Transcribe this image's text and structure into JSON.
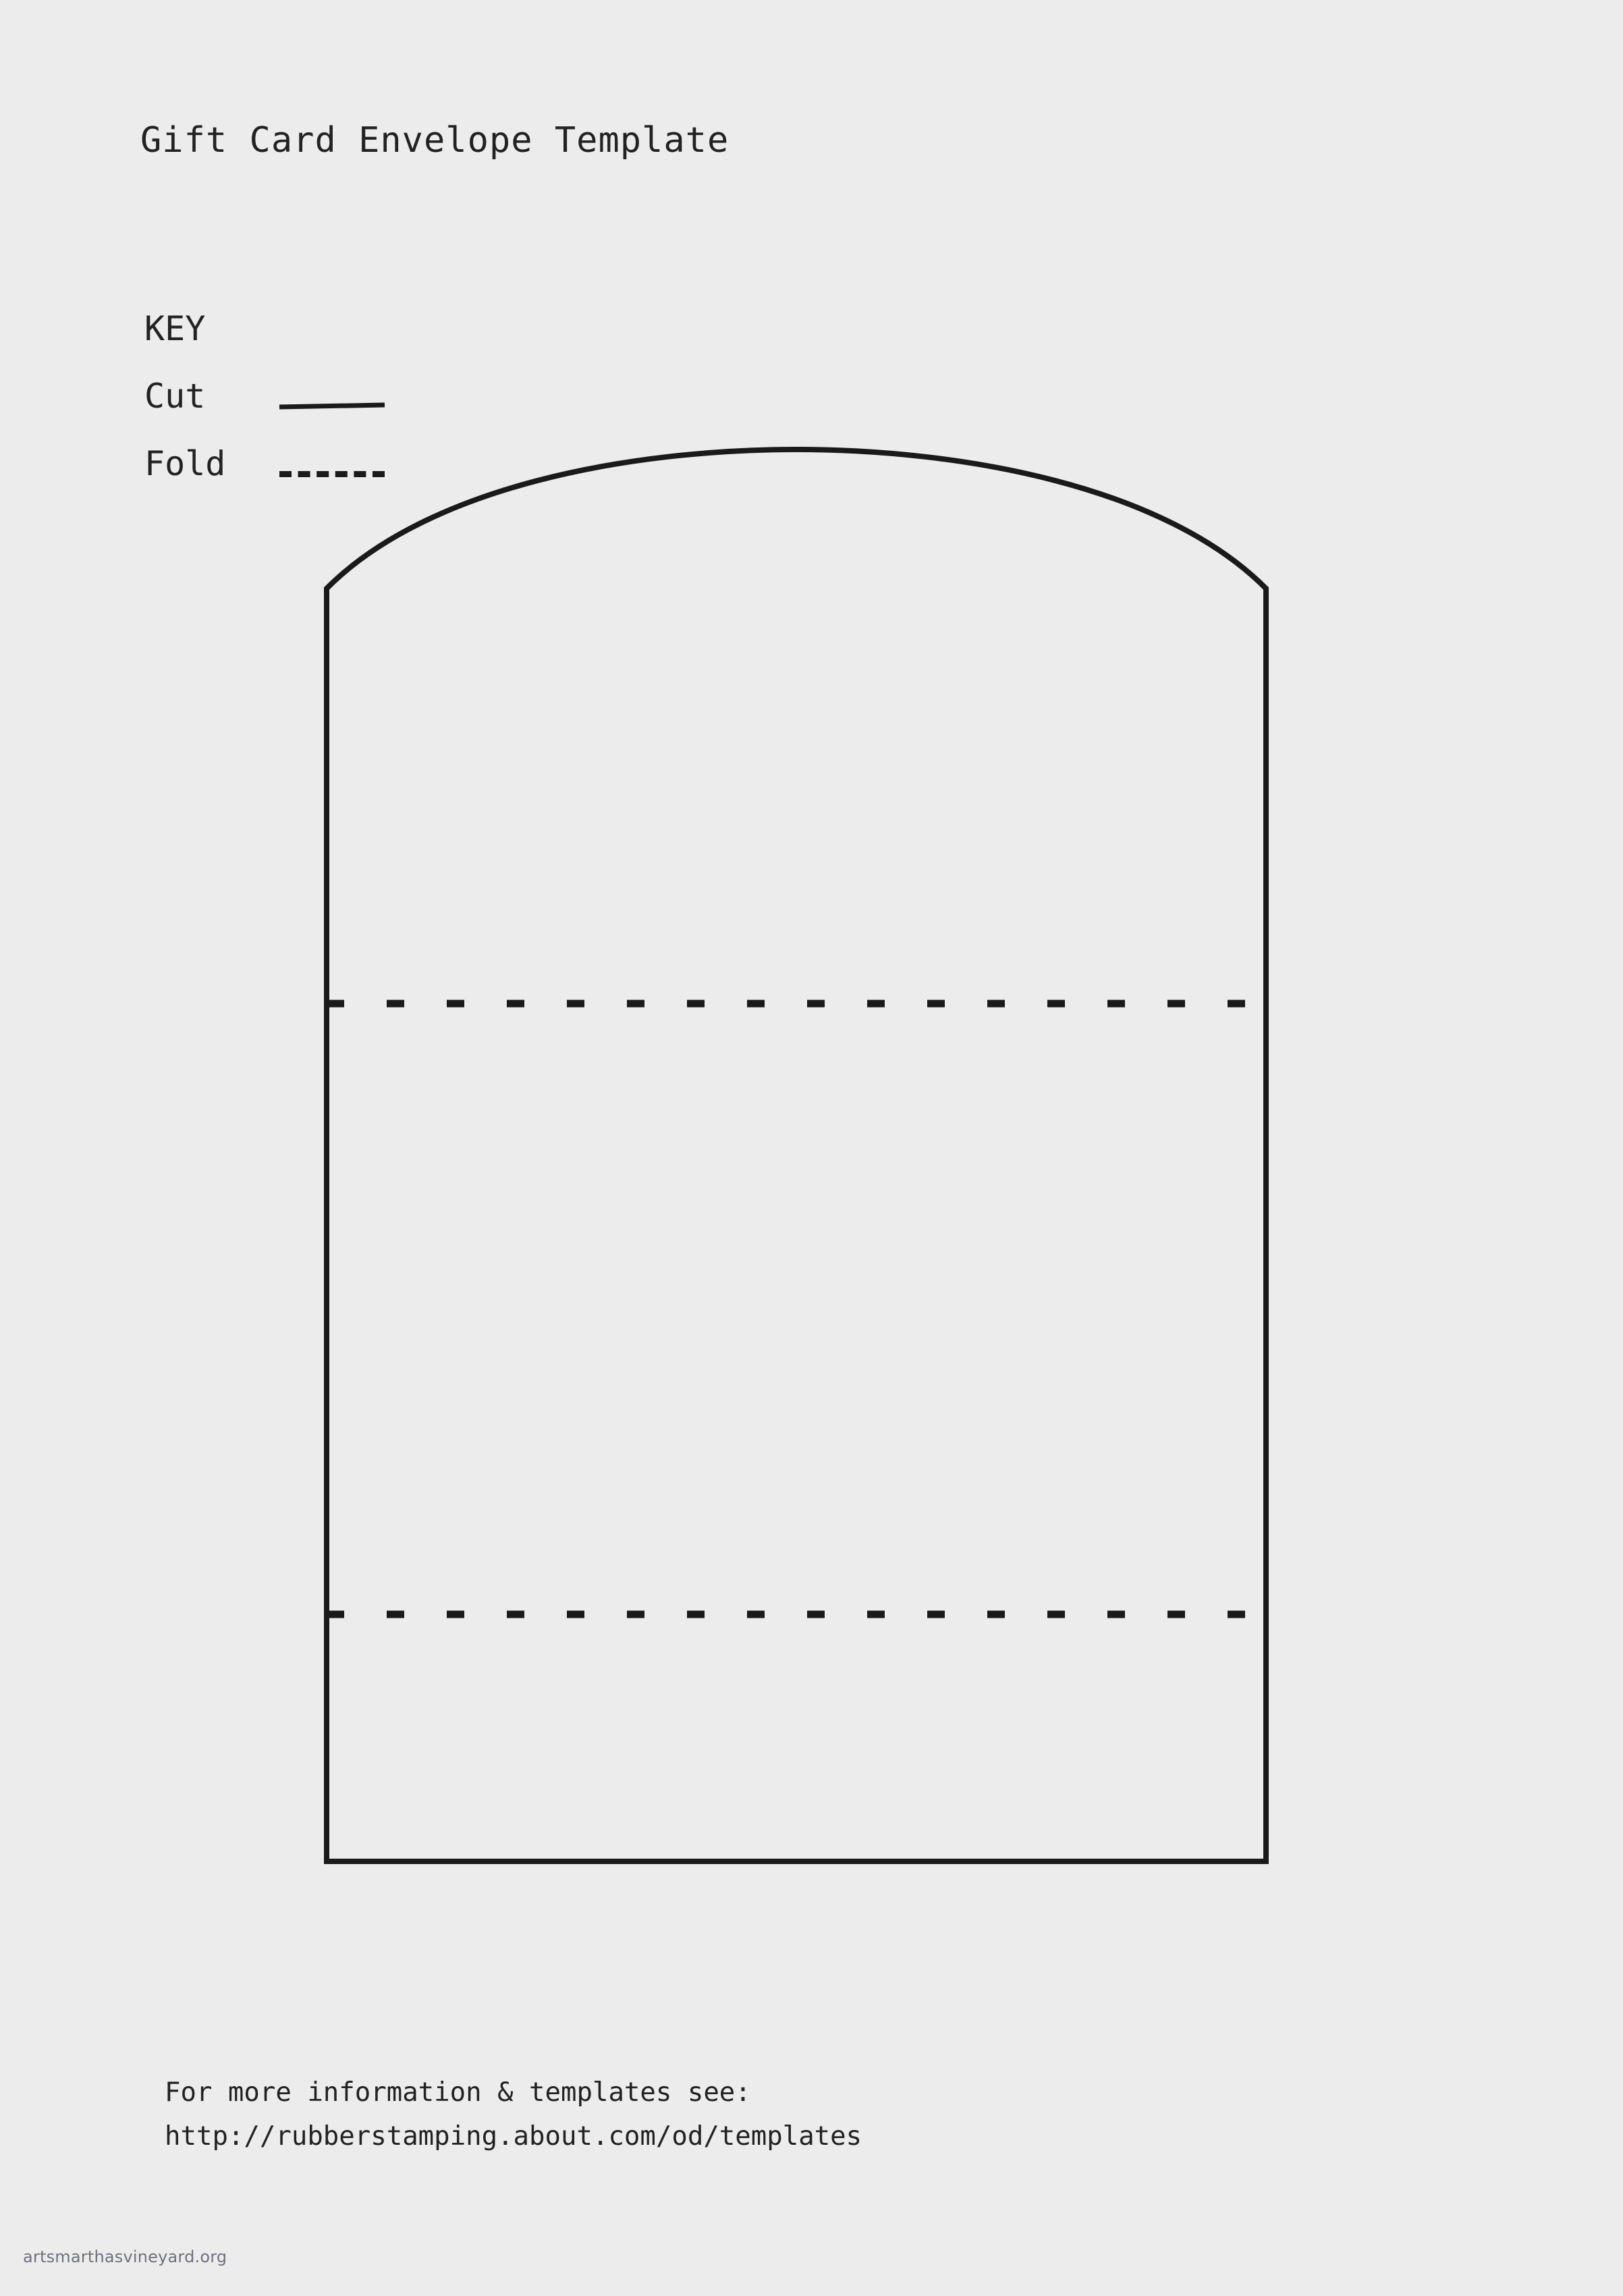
{
  "document": {
    "title": "Gift Card Envelope Template",
    "background_color": "#ececec",
    "ink_color": "#1a1a1a"
  },
  "key": {
    "heading": "KEY",
    "items": [
      {
        "label": "Cut",
        "line_style": "solid"
      },
      {
        "label": "Fold",
        "line_style": "dashed"
      }
    ]
  },
  "template_shape": {
    "name": "gift-card-envelope",
    "outline_style": "solid",
    "flap_style": "arched-top",
    "fold_lines": [
      {
        "name": "upper-fold-line",
        "style": "dashed"
      },
      {
        "name": "lower-fold-line",
        "style": "dashed"
      }
    ]
  },
  "footer": {
    "line1": "For more information & templates see:",
    "line2": "http://rubberstamping.about.com/od/templates"
  },
  "watermark": {
    "text": "artsmarthasvineyard.org",
    "color": "#6b7280"
  }
}
